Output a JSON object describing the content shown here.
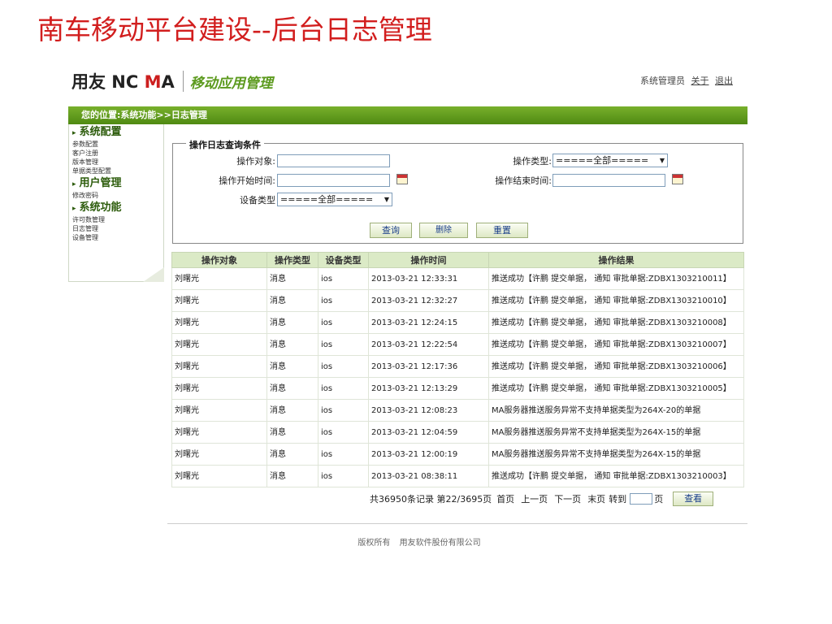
{
  "slide_title": "南车移动平台建设--后台日志管理",
  "header": {
    "brand_part1": "用友 NC ",
    "brand_m": "M",
    "brand_part2": "A",
    "app_name": "移动应用管理",
    "user": "系统管理员",
    "about": "关于",
    "logout": "退出"
  },
  "breadcrumb": "您的位置:系统功能>>日志管理",
  "sidebar": {
    "groups": [
      {
        "label": "系统配置",
        "items": [
          "参数配置",
          "客户注册",
          "版本管理",
          "单据类型配置"
        ]
      },
      {
        "label": "用户管理",
        "items": [
          "修改密码"
        ]
      },
      {
        "label": "系统功能",
        "items": [
          "许可数管理",
          "日志管理",
          "设备管理"
        ]
      }
    ]
  },
  "query": {
    "legend": "操作日志查询条件",
    "object_label": "操作对象:",
    "type_label": "操作类型:",
    "type_value": "=====全部=====",
    "start_label": "操作开始时间:",
    "end_label": "操作结束时间:",
    "device_label": "设备类型",
    "device_value": "=====全部=====",
    "btn_query": "查询",
    "btn_delete": "删除",
    "btn_reset": "重置"
  },
  "table": {
    "columns": [
      "操作对象",
      "操作类型",
      "设备类型",
      "操作时间",
      "操作结果"
    ],
    "rows": [
      [
        "刘曙光",
        "消息",
        "ios",
        "2013-03-21 12:33:31",
        "推送成功【许鹏 提交单据， 通知 审批单据:ZDBX1303210011】"
      ],
      [
        "刘曙光",
        "消息",
        "ios",
        "2013-03-21 12:32:27",
        "推送成功【许鹏 提交单据， 通知 审批单据:ZDBX1303210010】"
      ],
      [
        "刘曙光",
        "消息",
        "ios",
        "2013-03-21 12:24:15",
        "推送成功【许鹏 提交单据， 通知 审批单据:ZDBX1303210008】"
      ],
      [
        "刘曙光",
        "消息",
        "ios",
        "2013-03-21 12:22:54",
        "推送成功【许鹏 提交单据， 通知 审批单据:ZDBX1303210007】"
      ],
      [
        "刘曙光",
        "消息",
        "ios",
        "2013-03-21 12:17:36",
        "推送成功【许鹏 提交单据， 通知 审批单据:ZDBX1303210006】"
      ],
      [
        "刘曙光",
        "消息",
        "ios",
        "2013-03-21 12:13:29",
        "推送成功【许鹏 提交单据， 通知 审批单据:ZDBX1303210005】"
      ],
      [
        "刘曙光",
        "消息",
        "ios",
        "2013-03-21 12:08:23",
        "MA服务器推送服务异常不支持单据类型为264X-20的单据"
      ],
      [
        "刘曙光",
        "消息",
        "ios",
        "2013-03-21 12:04:59",
        "MA服务器推送服务异常不支持单据类型为264X-15的单据"
      ],
      [
        "刘曙光",
        "消息",
        "ios",
        "2013-03-21 12:00:19",
        "MA服务器推送服务异常不支持单据类型为264X-15的单据"
      ],
      [
        "刘曙光",
        "消息",
        "ios",
        "2013-03-21 08:38:11",
        "推送成功【许鹏 提交单据， 通知 审批单据:ZDBX1303210003】"
      ]
    ]
  },
  "pager": {
    "summary": "共36950条记录 第22/3695页",
    "first": "首页",
    "prev": "上一页",
    "next": "下一页",
    "last": "末页",
    "goto": "转到",
    "page_unit": "页",
    "view": "查看"
  },
  "footer": {
    "copyright": "版权所有",
    "company": "用友软件股份有限公司"
  }
}
